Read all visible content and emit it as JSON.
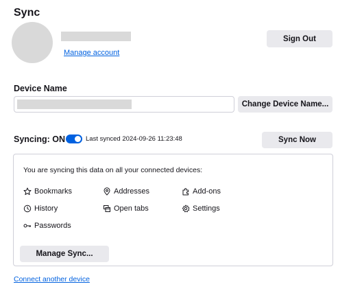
{
  "title": "Sync",
  "account": {
    "manage_label": "Manage account",
    "sign_out_label": "Sign Out"
  },
  "device": {
    "heading": "Device Name",
    "change_label": "Change Device Name..."
  },
  "sync": {
    "status_label": "Syncing: ON",
    "toggle_on": true,
    "last_synced": "Last synced 2024-09-26 11:23:48",
    "sync_now_label": "Sync Now",
    "intro": "You are syncing this data on all your connected devices:",
    "items": [
      {
        "label": "Bookmarks",
        "icon": "star-icon"
      },
      {
        "label": "Addresses",
        "icon": "location-pin-icon"
      },
      {
        "label": "Add-ons",
        "icon": "puzzle-icon"
      },
      {
        "label": "History",
        "icon": "clock-icon"
      },
      {
        "label": "Open tabs",
        "icon": "tabs-icon"
      },
      {
        "label": "Settings",
        "icon": "gear-icon"
      },
      {
        "label": "Passwords",
        "icon": "key-icon"
      }
    ],
    "manage_sync_label": "Manage Sync..."
  },
  "connect_label": "Connect another device",
  "colors": {
    "accent": "#0061e0",
    "button_bg": "#e9e9ed",
    "placeholder": "#d9d9d9"
  }
}
